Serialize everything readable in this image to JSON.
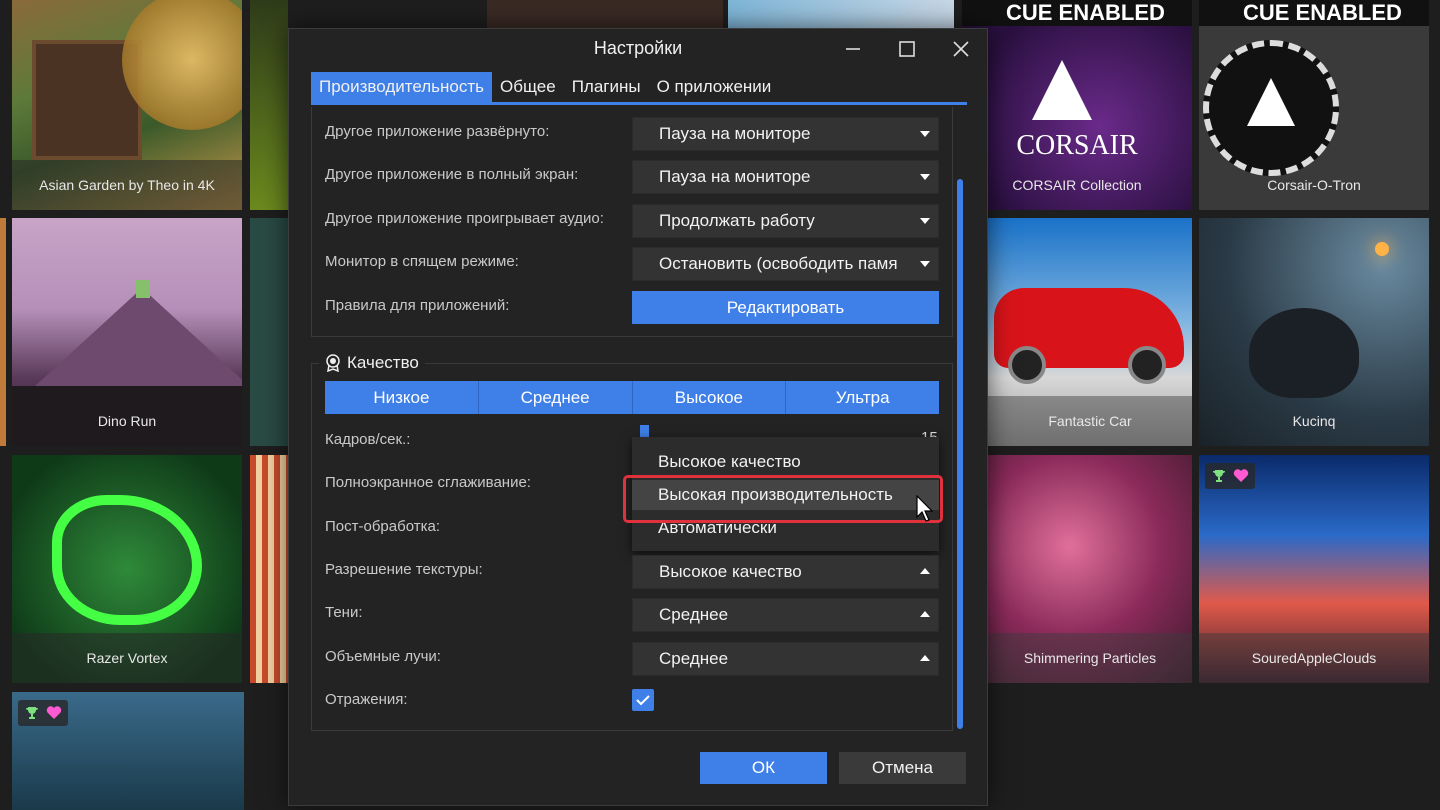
{
  "window": {
    "title": "Настройки"
  },
  "tabs": [
    {
      "label": "Производительность",
      "active": true
    },
    {
      "label": "Общее",
      "active": false
    },
    {
      "label": "Плагины",
      "active": false
    },
    {
      "label": "О приложении",
      "active": false
    }
  ],
  "playback": {
    "rows": [
      {
        "label": "Другое приложение развёрнуто:",
        "value": "Пауза на мониторе"
      },
      {
        "label": "Другое приложение в полный экран:",
        "value": "Пауза на мониторе"
      },
      {
        "label": "Другое приложение проигрывает аудио:",
        "value": "Продолжать работу"
      },
      {
        "label": "Монитор в спящем режиме:",
        "value": "Остановить (освободить памя"
      }
    ],
    "app_rules_label": "Правила для приложений:",
    "edit_button": "Редактировать"
  },
  "quality": {
    "title": "Качество",
    "presets": [
      "Низкое",
      "Среднее",
      "Высокое",
      "Ультра"
    ],
    "fps_label": "Кадров/сек.:",
    "fps_value": "15",
    "aa_label": "Полноэкранное сглаживание:",
    "post_label": "Пост-обработка:",
    "texture_label": "Разрешение текстуры:",
    "texture_value": "Высокое качество",
    "shadows_label": "Тени:",
    "shadows_value": "Среднее",
    "rays_label": "Объемные лучи:",
    "rays_value": "Среднее",
    "reflections_label": "Отражения:",
    "reflections_checked": true,
    "dropdown_options": [
      "Высокое качество",
      "Высокая производительность",
      "Автоматически"
    ],
    "dropdown_hovered": "Высокая производительность"
  },
  "footer": {
    "ok": "ОК",
    "cancel": "Отмена"
  },
  "background_tiles": [
    {
      "label": "Asian Garden by Theo in 4K"
    },
    {
      "label": "CORSAIR Collection"
    },
    {
      "label": "Corsair-O-Tron"
    },
    {
      "label": "Dino Run"
    },
    {
      "label": "Fantastic Car"
    },
    {
      "label": "Kucinq"
    },
    {
      "label": "Razer Vortex"
    },
    {
      "label": "Shimmering Particles"
    },
    {
      "label": "SouredAppleClouds"
    }
  ],
  "branding": {
    "cue_text": "CUE ENABLED",
    "corsair_text": "CORSAIR"
  },
  "colors": {
    "accent": "#3f7fe8",
    "dialog_bg": "#232323",
    "highlight": "#e0323c"
  }
}
